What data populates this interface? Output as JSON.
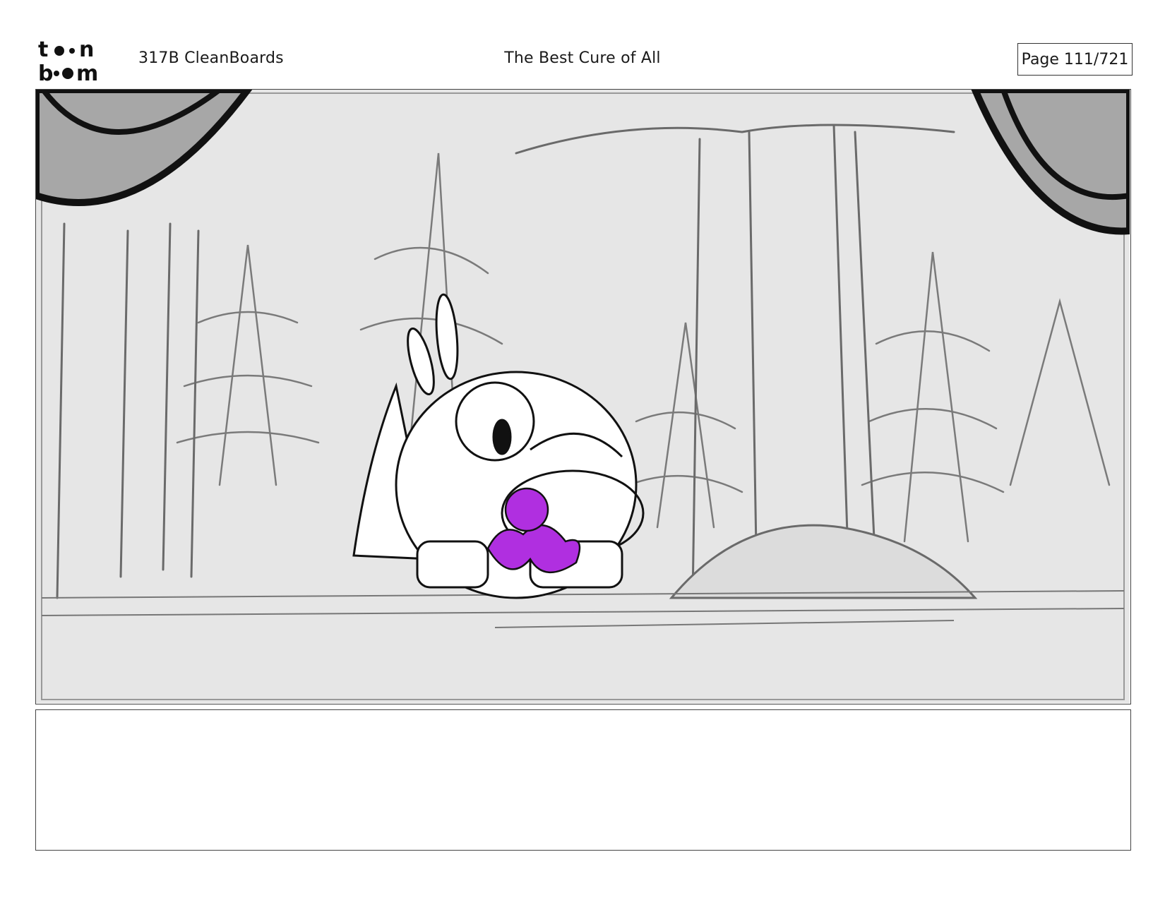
{
  "header": {
    "logo_text_top": "toon",
    "logo_text_bottom": "boom",
    "episode": "317B  CleanBoards",
    "title": "The Best Cure of All",
    "page": "Page 111/721"
  },
  "panel": {
    "scene": "forest-with-creature",
    "accent_color": "#b02fe0",
    "background_color": "#e6e6e6"
  },
  "notes": {
    "text": ""
  }
}
